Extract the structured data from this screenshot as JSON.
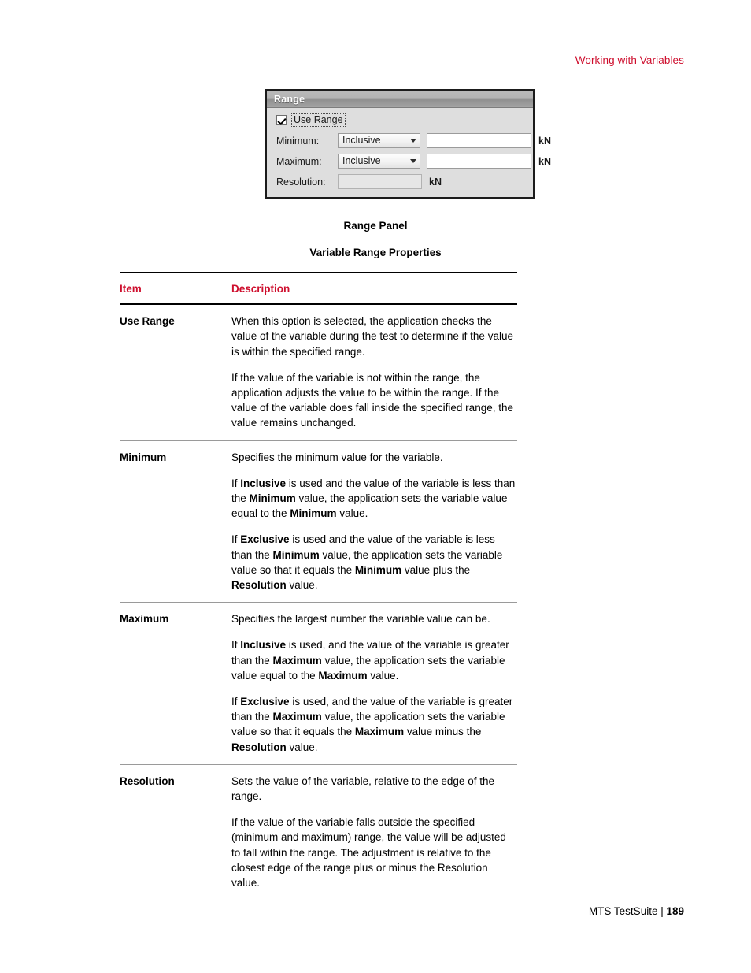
{
  "header": {
    "running_head": "Working with Variables",
    "accent_color": "#CE0E2D"
  },
  "figure": {
    "panel": {
      "title": "Range",
      "use_range": {
        "label": "Use Range",
        "checked": true
      },
      "rows": [
        {
          "label": "Minimum:",
          "select_value": "Inclusive",
          "input_value": "",
          "unit": "kN"
        },
        {
          "label": "Maximum:",
          "select_value": "Inclusive",
          "input_value": "",
          "unit": "kN"
        }
      ],
      "resolution": {
        "label": "Resolution:",
        "input_value": "",
        "unit": "kN"
      }
    },
    "caption": "Range Panel"
  },
  "table": {
    "title": "Variable Range Properties",
    "columns": {
      "item": "Item",
      "description": "Description"
    },
    "rows": [
      {
        "item": "Use Range",
        "paragraphs": [
          "When this option is selected, the application checks the value of the variable during the test to determine if the value is within the specified range.",
          "If the value of the variable is not within the range, the application adjusts the value to be within the range. If the value of the variable does fall inside the specified range, the value remains unchanged."
        ]
      },
      {
        "item": "Minimum",
        "paragraphs": [
          "Specifies the minimum value for the variable.",
          "If Inclusive is used and the value of the variable is less than the Minimum value, the application sets the variable value equal to the Minimum value.",
          "If Exclusive is used and the value of the variable is less than the Minimum value, the application sets the variable value so that it equals the Minimum value plus the Resolution value."
        ]
      },
      {
        "item": "Maximum",
        "paragraphs": [
          "Specifies the largest number the variable value can be.",
          "If Inclusive is used, and the value of the variable is greater than the Maximum value, the application sets the variable value equal to the Maximum value.",
          "If Exclusive is used, and the value of the variable is greater than the Maximum value, the application sets the variable value so that it equals the Maximum value minus the Resolution value."
        ]
      },
      {
        "item": "Resolution",
        "paragraphs": [
          "Sets the value of the variable, relative to the edge of the range.",
          "If the value of the variable falls outside the specified (minimum and maximum) range, the value will be adjusted to fall within the range. The adjustment is relative to the closest edge of the range plus or minus the Resolution value."
        ]
      }
    ],
    "bold_terms": [
      "Inclusive",
      "Exclusive",
      "Minimum",
      "Maximum",
      "Resolution"
    ]
  },
  "footer": {
    "product": "MTS TestSuite | ",
    "page_number": "189"
  }
}
